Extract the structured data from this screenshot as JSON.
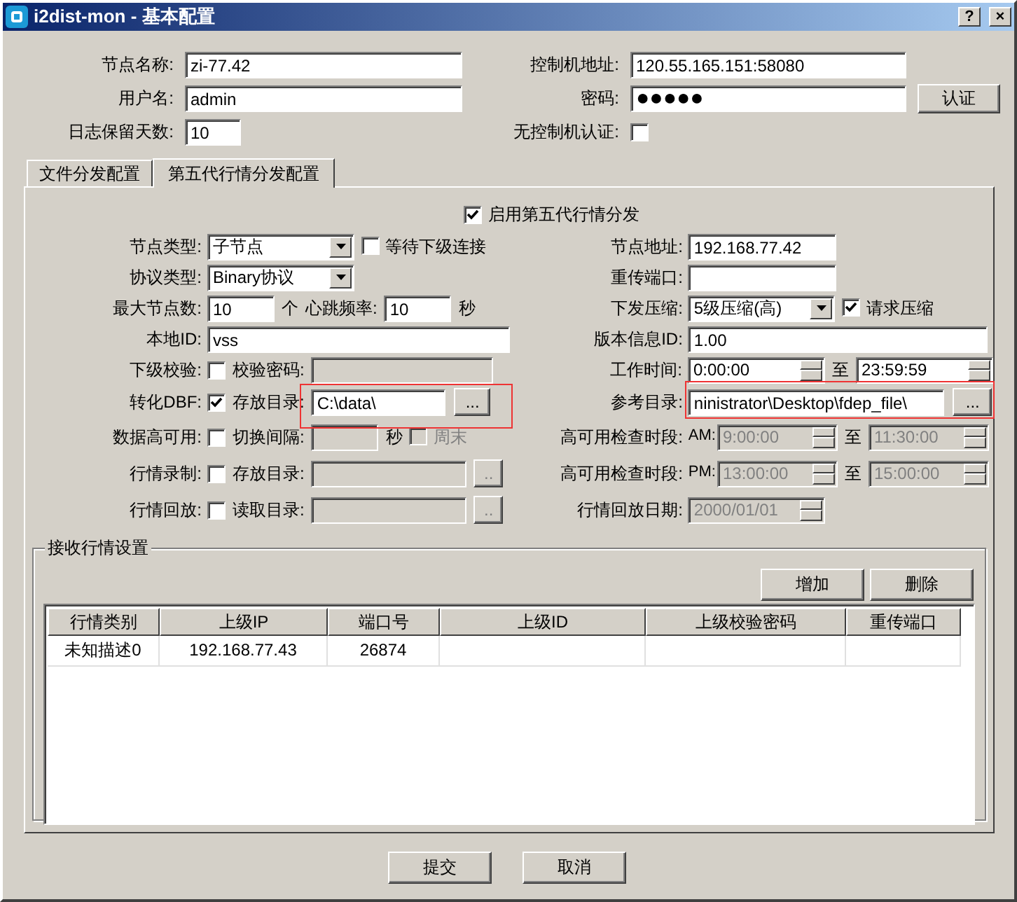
{
  "window": {
    "title": "i2dist-mon - 基本配置",
    "controls": [
      "?",
      "×"
    ]
  },
  "general": {
    "left": [
      {
        "label": "节点名称:",
        "kind": "text",
        "value": "zi-77.42"
      },
      {
        "label": "用户名:",
        "kind": "text",
        "value": "admin"
      },
      {
        "label": "日志保留天数:",
        "kind": "text",
        "value": "10"
      }
    ],
    "right": [
      {
        "label": "控制机地址:",
        "kind": "text",
        "value": "120.55.165.151:58080"
      },
      {
        "label": "密码:",
        "kind": "password",
        "value": "●●●●●",
        "button": "认证"
      },
      {
        "label": "无控制机认证:",
        "kind": "check",
        "checked": false
      }
    ]
  },
  "tabs": [
    {
      "label": "文件分发配置",
      "selected": false
    },
    {
      "label": "第五代行情分发配置",
      "selected": true
    }
  ],
  "enable": {
    "label": "启用第五代行情分发",
    "checked": true
  },
  "rows": [
    {
      "left": {
        "label": "节点类型:",
        "controls": [
          {
            "kind": "combo",
            "value": "子节点"
          },
          {
            "kind": "check",
            "label": "等待下级连接",
            "checked": false,
            "disabled": false
          }
        ]
      },
      "right": {
        "label": "节点地址:",
        "controls": [
          {
            "kind": "text",
            "value": "192.168.77.42",
            "disabled": false
          }
        ]
      }
    },
    {
      "left": {
        "label": "协议类型:",
        "controls": [
          {
            "kind": "combo",
            "value": "Binary协议"
          }
        ]
      },
      "right": {
        "label": "重传端口:",
        "controls": [
          {
            "kind": "text",
            "disabled": false
          }
        ]
      }
    },
    {
      "left": {
        "label": "最大节点数:",
        "controls": [
          {
            "kind": "text",
            "value": "10",
            "disabled": false
          },
          {
            "kind": "unit",
            "text": "个"
          },
          {
            "kind": "caption",
            "text": "心跳频率:"
          },
          {
            "kind": "text",
            "value": "10",
            "disabled": false
          },
          {
            "kind": "unit",
            "text": "秒"
          }
        ]
      },
      "right": {
        "label": "下发压缩:",
        "controls": [
          {
            "kind": "combo",
            "value": "5级压缩(高)"
          },
          {
            "kind": "check",
            "label": "请求压缩",
            "checked": true,
            "disabled": false
          }
        ]
      }
    },
    {
      "left": {
        "label": "本地ID:",
        "controls": [
          {
            "kind": "text",
            "value": "vss",
            "disabled": false
          }
        ]
      },
      "right": {
        "label": "版本信息ID:",
        "controls": [
          {
            "kind": "text",
            "value": "1.00",
            "disabled": false
          }
        ]
      }
    },
    {
      "left": {
        "label": "下级校验:",
        "controls": [
          {
            "kind": "check",
            "checked": false,
            "disabled": false
          },
          {
            "kind": "caption",
            "text": "校验密码:"
          },
          {
            "kind": "text",
            "disabled": true
          }
        ]
      },
      "right": {
        "label": "工作时间:",
        "controls": [
          {
            "kind": "spin",
            "value": "0:00:00",
            "disabled": false
          },
          {
            "kind": "unit",
            "text": "至"
          },
          {
            "kind": "spin",
            "value": "23:59:59",
            "disabled": false
          }
        ]
      }
    },
    {
      "left": {
        "label": "转化DBF:",
        "controls": [
          {
            "kind": "check",
            "checked": true,
            "disabled": false
          },
          {
            "kind": "caption",
            "text": "存放目录:"
          },
          {
            "kind": "text",
            "value": "C:\\data\\",
            "disabled": false,
            "highlighted": true
          },
          {
            "kind": "browse",
            "label": "...",
            "disabled": false
          }
        ]
      },
      "right": {
        "label": "参考目录:",
        "controls": [
          {
            "kind": "text",
            "value": "ninistrator\\Desktop\\fdep_file\\",
            "disabled": false,
            "highlighted": true
          },
          {
            "kind": "browse",
            "label": "...",
            "disabled": false
          }
        ]
      }
    },
    {
      "left": {
        "label": "数据高可用:",
        "controls": [
          {
            "kind": "check",
            "checked": false,
            "disabled": false
          },
          {
            "kind": "caption",
            "text": "切换间隔:"
          },
          {
            "kind": "text",
            "disabled": true
          },
          {
            "kind": "unit",
            "text": "秒"
          },
          {
            "kind": "check",
            "label": "周末",
            "checked": false,
            "disabled": true
          }
        ]
      },
      "right": {
        "label": "高可用检查时段:",
        "controls": [
          {
            "kind": "caption",
            "text": "AM:"
          },
          {
            "kind": "spin",
            "value": "9:00:00",
            "disabled": true
          },
          {
            "kind": "unit",
            "text": "至"
          },
          {
            "kind": "spin",
            "value": "11:30:00",
            "disabled": true
          }
        ]
      }
    },
    {
      "left": {
        "label": "行情录制:",
        "controls": [
          {
            "kind": "check",
            "checked": false,
            "disabled": false
          },
          {
            "kind": "caption",
            "text": "存放目录:"
          },
          {
            "kind": "text",
            "disabled": true
          },
          {
            "kind": "browse",
            "label": "..",
            "disabled": true
          }
        ]
      },
      "right": {
        "label": "高可用检查时段:",
        "controls": [
          {
            "kind": "caption",
            "text": "PM:"
          },
          {
            "kind": "spin",
            "value": "13:00:00",
            "disabled": true
          },
          {
            "kind": "unit",
            "text": "至"
          },
          {
            "kind": "spin",
            "value": "15:00:00",
            "disabled": true
          }
        ]
      }
    },
    {
      "left": {
        "label": "行情回放:",
        "controls": [
          {
            "kind": "check",
            "checked": false,
            "disabled": false
          },
          {
            "kind": "caption",
            "text": "读取目录:"
          },
          {
            "kind": "text",
            "disabled": true
          },
          {
            "kind": "browse",
            "label": "..",
            "disabled": true
          }
        ]
      },
      "right": {
        "label": "行情回放日期:",
        "controls": [
          {
            "kind": "spin",
            "value": "2000/01/01",
            "disabled": true
          }
        ]
      }
    }
  ],
  "receive": {
    "title": "接收行情设置",
    "buttons": [
      "增加",
      "删除"
    ],
    "columns": [
      "行情类别",
      "上级IP",
      "端口号",
      "上级ID",
      "上级校验密码",
      "重传端口"
    ],
    "rows": [
      {
        "cells": [
          "未知描述0",
          "192.168.77.43",
          "26874"
        ]
      }
    ]
  },
  "footer": [
    "提交",
    "取消"
  ]
}
